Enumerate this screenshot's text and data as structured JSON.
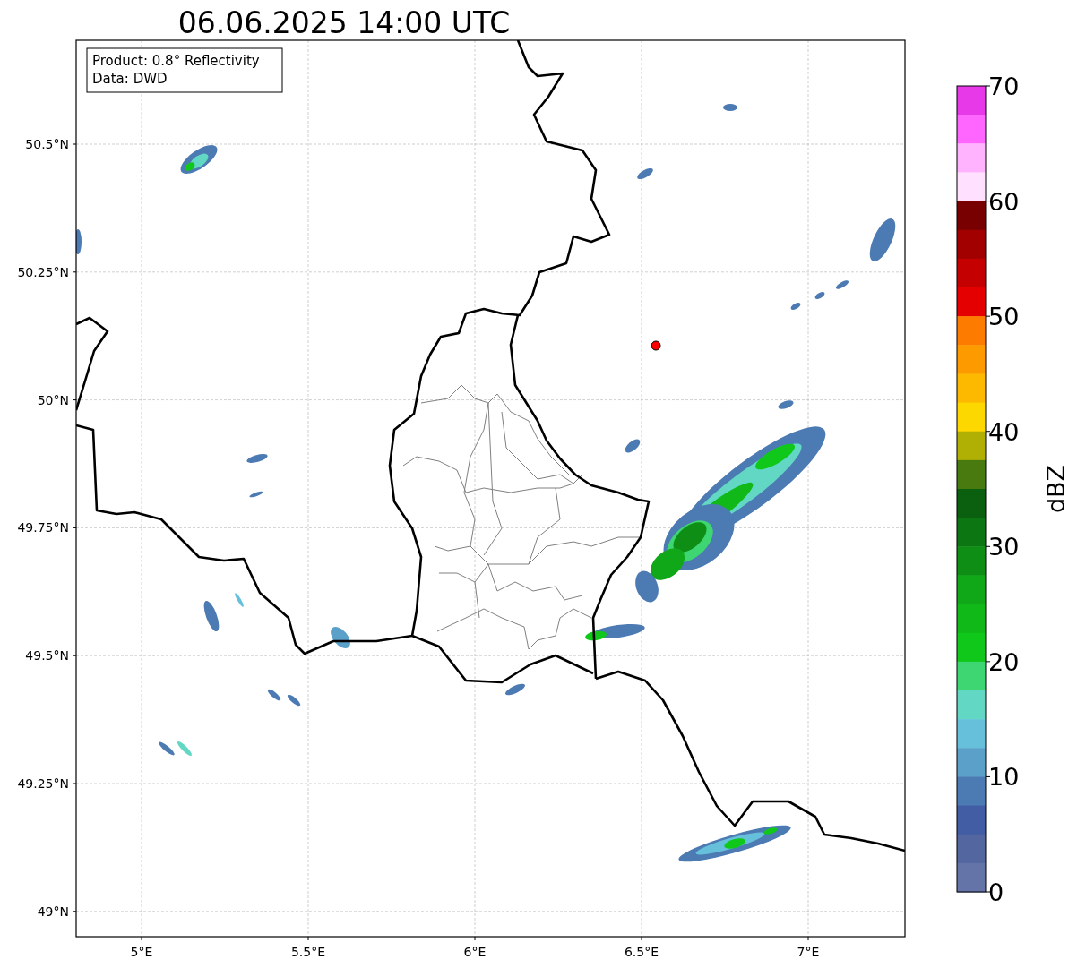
{
  "title": "06.06.2025 14:00 UTC",
  "info_box": {
    "lines": [
      "Product: 0.8° Reflectivity",
      "Data: DWD"
    ]
  },
  "map": {
    "xticks": [
      "5°E",
      "5.5°E",
      "6°E",
      "6.5°E",
      "7°E"
    ],
    "yticks": [
      "50.5°N",
      "50.25°N",
      "50°N",
      "49.75°N",
      "49.5°N",
      "49.25°N",
      "49°N"
    ]
  },
  "colorbar": {
    "label": "dBZ",
    "ticks": [
      "70",
      "60",
      "50",
      "40",
      "30",
      "20",
      "10",
      "0"
    ],
    "bands": [
      {
        "color": "#e839e8"
      },
      {
        "color": "#ff66ff"
      },
      {
        "color": "#ffb3ff"
      },
      {
        "color": "#ffe0ff"
      },
      {
        "color": "#780000"
      },
      {
        "color": "#a20000"
      },
      {
        "color": "#c40000"
      },
      {
        "color": "#e40000"
      },
      {
        "color": "#fd7c00"
      },
      {
        "color": "#fd9a00"
      },
      {
        "color": "#fdb800"
      },
      {
        "color": "#fdd700"
      },
      {
        "color": "#b0b004"
      },
      {
        "color": "#487a10"
      },
      {
        "color": "#0a600e"
      },
      {
        "color": "#0b7612"
      },
      {
        "color": "#0e8e14"
      },
      {
        "color": "#10a818"
      },
      {
        "color": "#10b818"
      },
      {
        "color": "#10c81a"
      },
      {
        "color": "#3ed672"
      },
      {
        "color": "#61d7c4"
      },
      {
        "color": "#66c0dc"
      },
      {
        "color": "#5ba0c8"
      },
      {
        "color": "#4c7ab3"
      },
      {
        "color": "#425da3"
      },
      {
        "color": "#5366a0"
      },
      {
        "color": "#6473a8"
      }
    ]
  }
}
